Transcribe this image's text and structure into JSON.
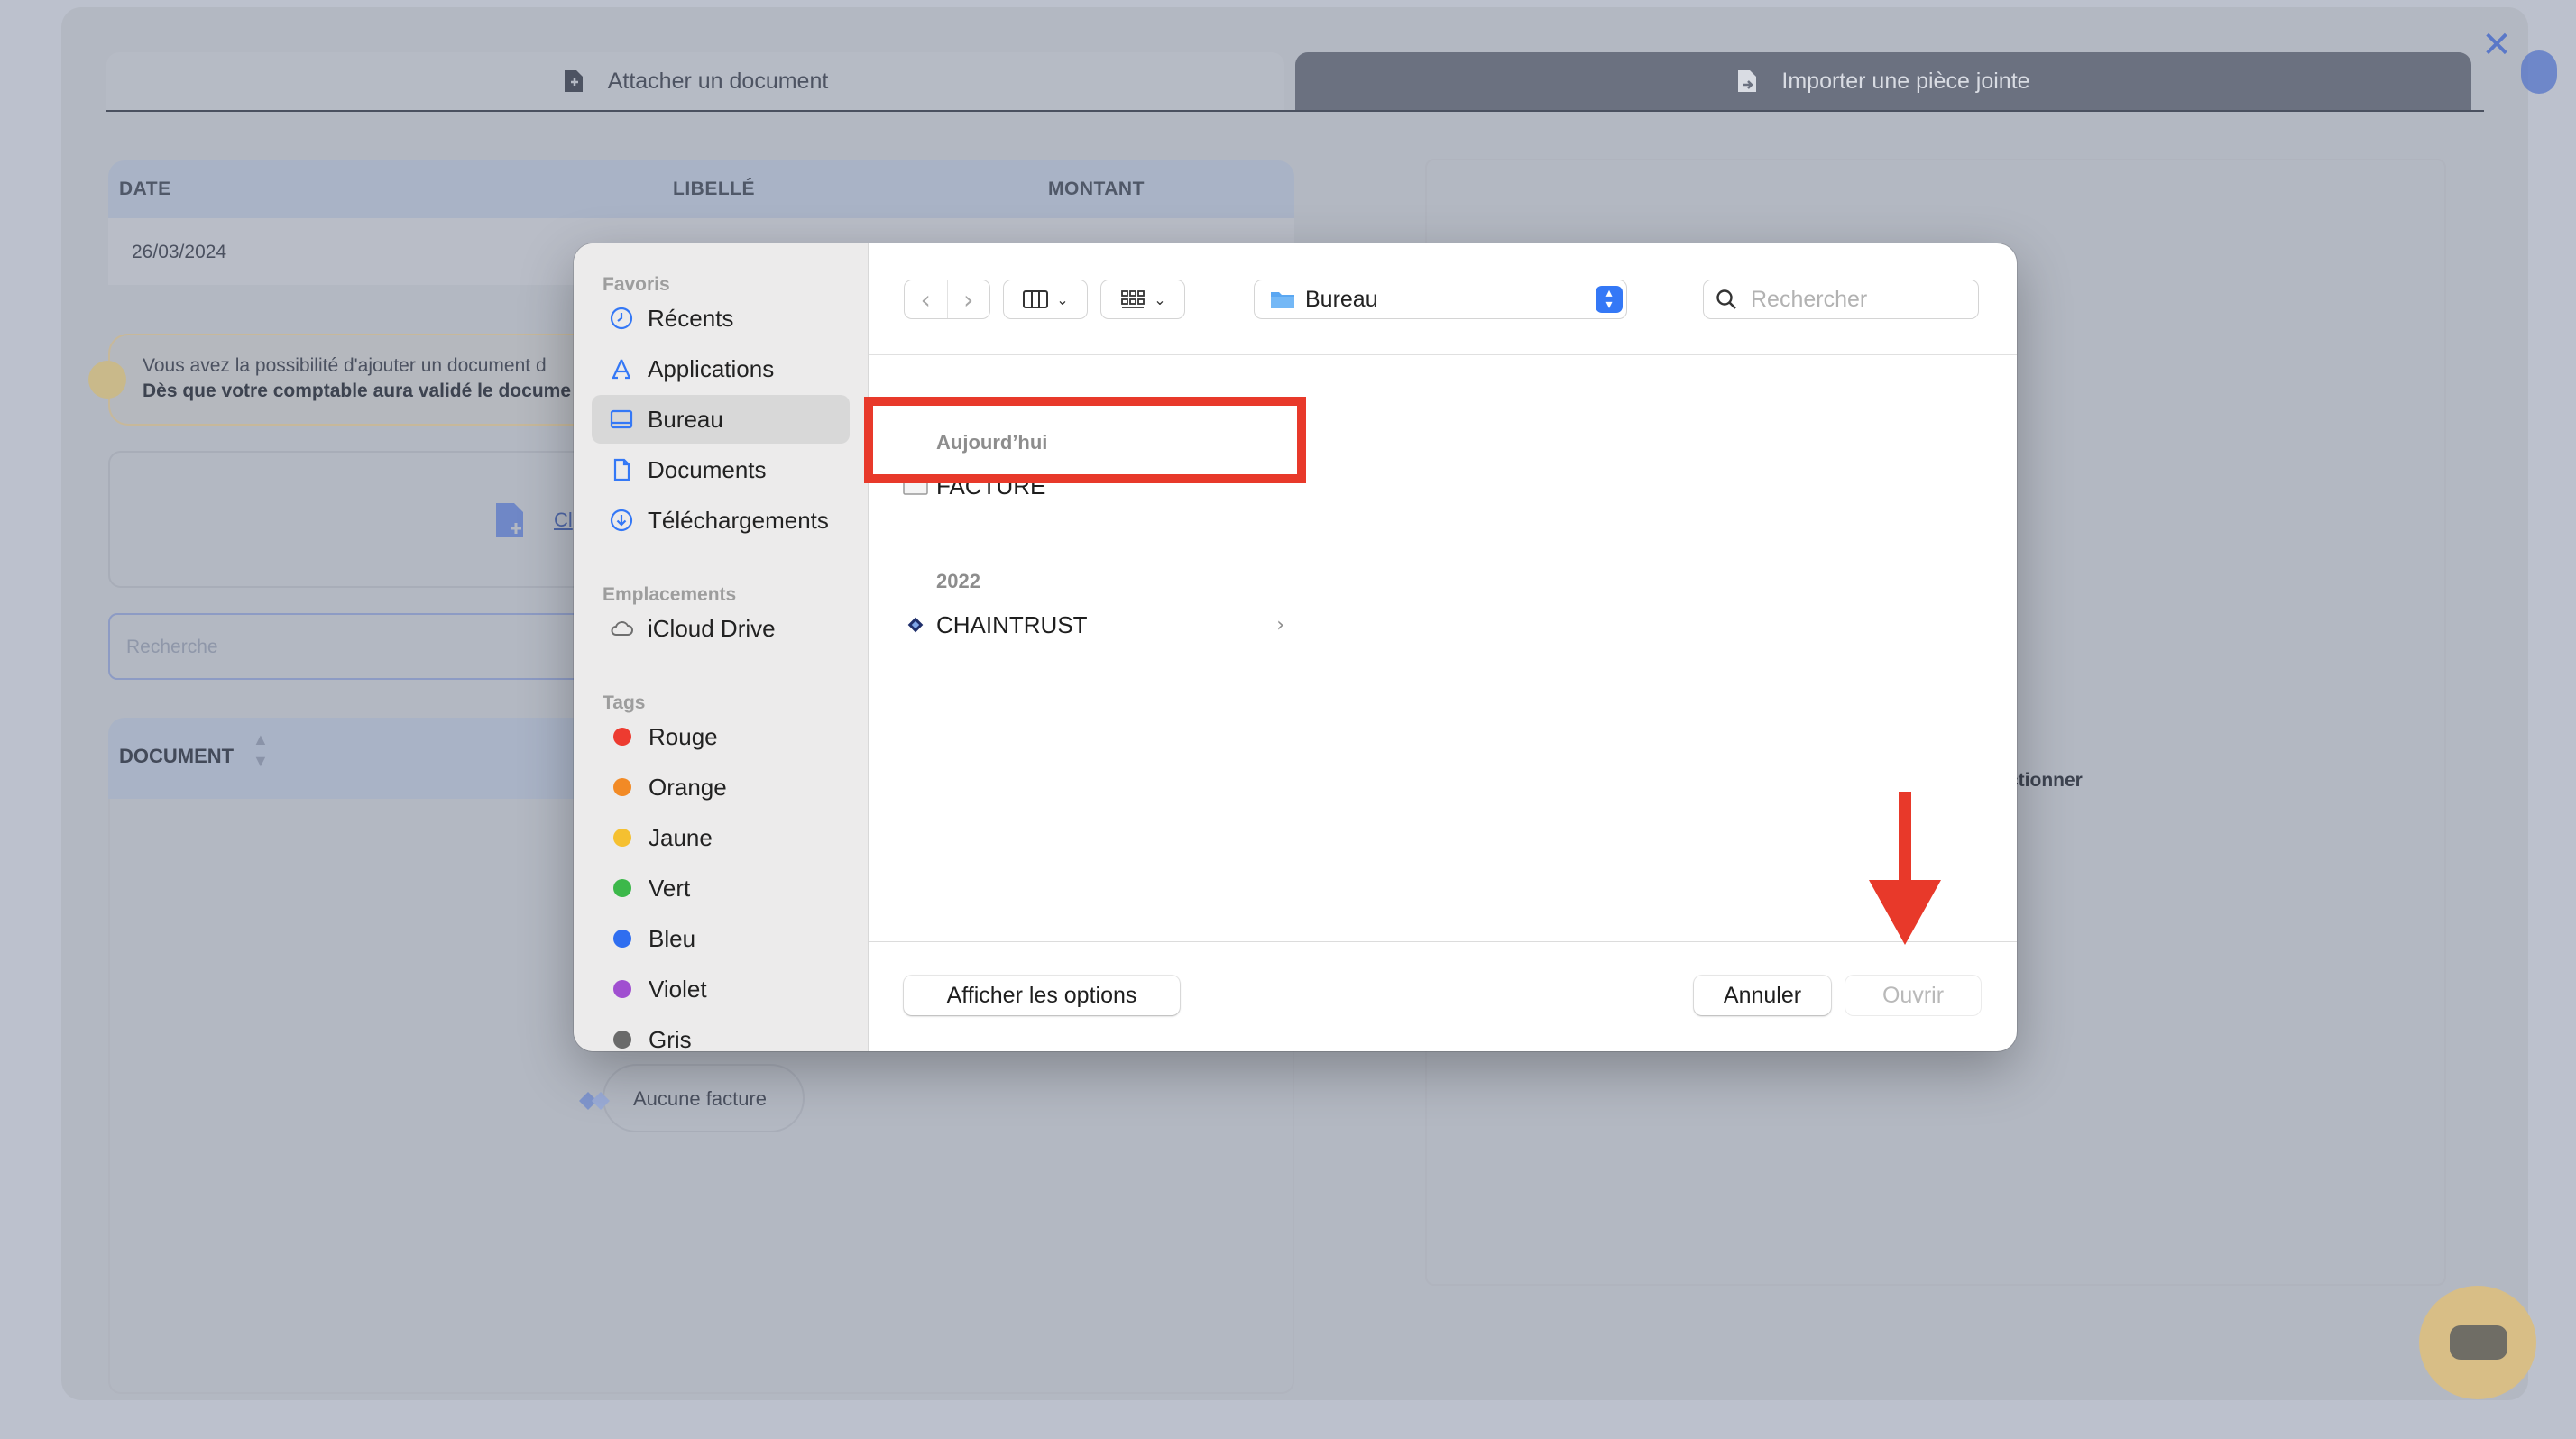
{
  "background": {
    "tabs": [
      {
        "label": "Attacher un document",
        "icon": "file-add-icon",
        "active": false
      },
      {
        "label": "Importer une pièce jointe",
        "icon": "file-import-icon",
        "active": true
      }
    ],
    "table": {
      "headers": [
        "DATE",
        "LIBELLÉ",
        "MONTANT"
      ],
      "row": {
        "date": "26/03/2024"
      }
    },
    "info": {
      "line1": "Vous avez la possibilité d'ajouter un document d",
      "line2": "Dès que votre comptable aura validé le docume"
    },
    "drop_link": "Cl",
    "search_placeholder": "Recherche",
    "document_header": "DOCUMENT",
    "empty_state": "Aucune facture",
    "right_partial_text": "ctionner",
    "close_glyph": "✕"
  },
  "dialog": {
    "sidebar": {
      "favorites_title": "Favoris",
      "favorites": [
        {
          "label": "Récents",
          "icon": "clock-icon",
          "selected": false
        },
        {
          "label": "Applications",
          "icon": "applications-icon",
          "selected": false
        },
        {
          "label": "Bureau",
          "icon": "desktop-icon",
          "selected": true
        },
        {
          "label": "Documents",
          "icon": "document-icon",
          "selected": false
        },
        {
          "label": "Téléchargements",
          "icon": "download-icon",
          "selected": false
        }
      ],
      "locations_title": "Emplacements",
      "locations": [
        {
          "label": "iCloud Drive",
          "icon": "cloud-icon"
        }
      ],
      "tags_title": "Tags",
      "tags": [
        {
          "label": "Rouge",
          "color": "#ed3b30"
        },
        {
          "label": "Orange",
          "color": "#f28a25"
        },
        {
          "label": "Jaune",
          "color": "#f5c030"
        },
        {
          "label": "Vert",
          "color": "#3cb84a"
        },
        {
          "label": "Bleu",
          "color": "#2f6ef0"
        },
        {
          "label": "Violet",
          "color": "#a04fd0"
        },
        {
          "label": "Gris",
          "color": "#8e8e8e"
        }
      ]
    },
    "toolbar": {
      "location": "Bureau",
      "search_placeholder": "Rechercher"
    },
    "column": {
      "today_title": "Aujourd’hui",
      "today_items": [
        {
          "name": "FACTURE",
          "icon": "folder-outline-icon"
        }
      ],
      "year_title": "2022",
      "year_items": [
        {
          "name": "CHAINTRUST",
          "icon": "chaintrust-logo-icon"
        }
      ]
    },
    "footer": {
      "options_label": "Afficher les options",
      "cancel_label": "Annuler",
      "open_label": "Ouvrir"
    }
  },
  "colors": {
    "annotation_red": "#e8392a",
    "accent_blue": "#3478f6"
  }
}
